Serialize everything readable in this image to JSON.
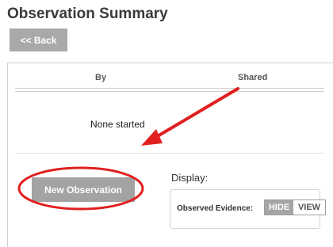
{
  "page": {
    "title": "Observation Summary"
  },
  "toolbar": {
    "back_label": "<< Back"
  },
  "table": {
    "columns": [
      "By",
      "Shared"
    ],
    "empty_message": "None started"
  },
  "actions": {
    "new_observation_label": "New Observation"
  },
  "display": {
    "label": "Display:",
    "observed_evidence_label": "Observed Evidence:",
    "toggle_options": [
      "HIDE",
      "VIEW"
    ],
    "selected": "HIDE"
  },
  "annotations": {
    "arrow_color": "#e02020",
    "circle_color": "#e02020"
  },
  "colors": {
    "button_gray": "#a9a9a9",
    "title_text": "#3a3a3a"
  }
}
